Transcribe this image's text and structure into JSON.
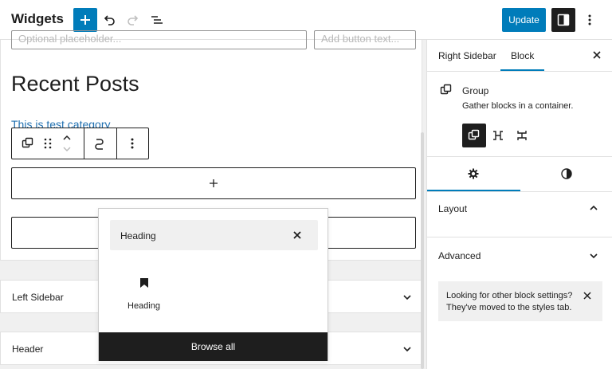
{
  "header": {
    "title": "Widgets",
    "update_label": "Update"
  },
  "editor": {
    "field_placeholder_1": "Optional placeholder...",
    "field_placeholder_2": "Add button text...",
    "heading": "Recent Posts",
    "category_link": "This is test category",
    "areas": [
      {
        "label": "Left Sidebar"
      },
      {
        "label": "Header"
      }
    ]
  },
  "inserter": {
    "search_value": "Heading",
    "result_label": "Heading",
    "browse_all_label": "Browse all"
  },
  "sidebar": {
    "tabs": [
      {
        "label": "Right Sidebar",
        "active": false
      },
      {
        "label": "Block",
        "active": true
      }
    ],
    "block": {
      "name": "Group",
      "description": "Gather blocks in a container."
    },
    "panels": [
      {
        "title": "Layout",
        "expanded": true
      },
      {
        "title": "Advanced",
        "expanded": false
      }
    ],
    "notice": "Looking for other block settings? They've moved to the styles tab."
  },
  "colors": {
    "accent": "#007cba",
    "dark": "#1e1e1e",
    "link": "#2271b1"
  },
  "icons": [
    "plus-icon",
    "undo-icon",
    "redo-icon",
    "list-view-icon",
    "sidebar-toggle-icon",
    "more-vertical-icon",
    "close-icon",
    "group-icon",
    "drag-handle-icon",
    "move-up-icon",
    "move-down-icon",
    "link-icon",
    "row-icon",
    "stack-icon",
    "gear-icon",
    "contrast-icon",
    "chevron-up-icon",
    "chevron-down-icon",
    "bookmark-icon"
  ]
}
